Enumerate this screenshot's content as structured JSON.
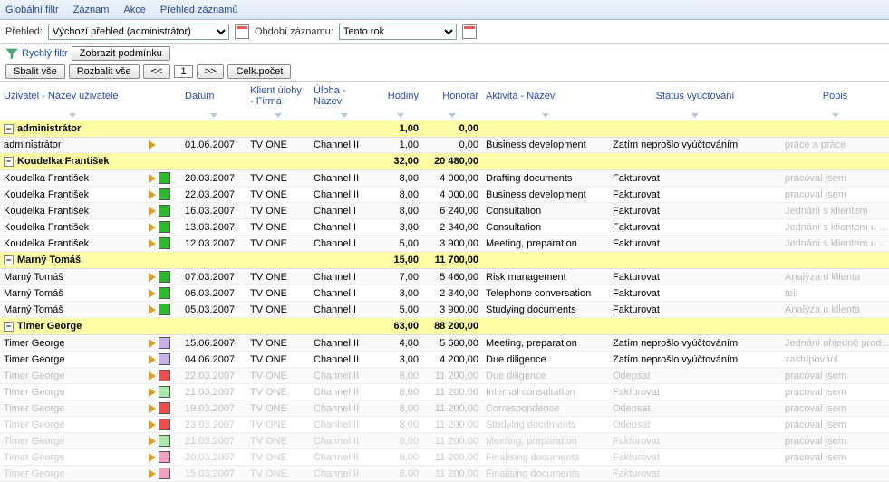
{
  "menu": [
    "Globální filtr",
    "Záznam",
    "Akce",
    "Přehled záznamů"
  ],
  "toolbar1": {
    "prehled_label": "Přehled:",
    "prehled_value": "Výchozí přehled (administrátor)",
    "obdobi_label": "Období záznamu:",
    "obdobi_value": "Tento rok"
  },
  "toolbar2": {
    "quick_filter": "Rychlý filtr",
    "show_condition": "Zobrazit podmínku"
  },
  "toolbar3": {
    "collapse_all": "Sbalit vše",
    "expand_all": "Rozbalit vše",
    "prev": "<<",
    "page": "1",
    "next": ">>",
    "total": "Celk.počet"
  },
  "headers": {
    "user": "Uživatel - Název uživatele",
    "date": "Datum",
    "client": "Klient úlohy - Firma",
    "task": "Úloha - Název",
    "hours": "Hodiny",
    "fee": "Honorář",
    "activity": "Aktivita - Název",
    "status": "Status vyúčtování",
    "desc": "Popis"
  },
  "groups": [
    {
      "name": "administrátor",
      "hours": "1,00",
      "fee": "0,00",
      "rows": [
        {
          "user": "administrátor",
          "sq": "",
          "date": "01.06.2007",
          "client": "TV ONE",
          "task": "Channel II",
          "hours": "1,00",
          "fee": "0,00",
          "activity": "Business development",
          "status": "Zatím neprošlo vyúčtováním",
          "desc": "práce a práce",
          "fade": 0
        }
      ]
    },
    {
      "name": "Koudelka František",
      "hours": "32,00",
      "fee": "20 480,00",
      "rows": [
        {
          "user": "Koudelka František",
          "sq": "green",
          "date": "20.03.2007",
          "client": "TV ONE",
          "task": "Channel II",
          "hours": "8,00",
          "fee": "4 000,00",
          "activity": "Drafting documents",
          "status": "Fakturovat",
          "desc": "pracoval jsem",
          "fade": 0
        },
        {
          "user": "Koudelka František",
          "sq": "green",
          "date": "22.03.2007",
          "client": "TV ONE",
          "task": "Channel II",
          "hours": "8,00",
          "fee": "4 000,00",
          "activity": "Business development",
          "status": "Fakturovat",
          "desc": "pracoval jsem",
          "fade": 0
        },
        {
          "user": "Koudelka František",
          "sq": "green",
          "date": "16.03.2007",
          "client": "TV ONE",
          "task": "Channel I",
          "hours": "8,00",
          "fee": "6 240,00",
          "activity": "Consultation",
          "status": "Fakturovat",
          "desc": "Jednání s klientem",
          "fade": 0
        },
        {
          "user": "Koudelka František",
          "sq": "green",
          "date": "13.03.2007",
          "client": "TV ONE",
          "task": "Channel I",
          "hours": "3,00",
          "fee": "2 340,00",
          "activity": "Consultation",
          "status": "Fakturovat",
          "desc": "Jednání s klientem u ...",
          "fade": 0
        },
        {
          "user": "Koudelka František",
          "sq": "green",
          "date": "12.03.2007",
          "client": "TV ONE",
          "task": "Channel I",
          "hours": "5,00",
          "fee": "3 900,00",
          "activity": "Meeting, preparation",
          "status": "Fakturovat",
          "desc": "Jednání s klientem u ...",
          "fade": 0
        }
      ]
    },
    {
      "name": "Marný Tomáš",
      "hours": "15,00",
      "fee": "11 700,00",
      "rows": [
        {
          "user": "Marný Tomáš",
          "sq": "green",
          "date": "07.03.2007",
          "client": "TV ONE",
          "task": "Channel I",
          "hours": "7,00",
          "fee": "5 460,00",
          "activity": "Risk management",
          "status": "Fakturovat",
          "desc": "Analýza u klienta",
          "fade": 0
        },
        {
          "user": "Marný Tomáš",
          "sq": "green",
          "date": "06.03.2007",
          "client": "TV ONE",
          "task": "Channel I",
          "hours": "3,00",
          "fee": "2 340,00",
          "activity": "Telephone conversation",
          "status": "Fakturovat",
          "desc": "tel",
          "fade": 0
        },
        {
          "user": "Marný Tomáš",
          "sq": "green",
          "date": "05.03.2007",
          "client": "TV ONE",
          "task": "Channel I",
          "hours": "5,00",
          "fee": "3 900,00",
          "activity": "Studying documents",
          "status": "Fakturovat",
          "desc": "Analýza u klienta",
          "fade": 0
        }
      ]
    },
    {
      "name": "Timer George",
      "hours": "63,00",
      "fee": "88 200,00",
      "rows": [
        {
          "user": "Timer George",
          "sq": "purple",
          "date": "15.06.2007",
          "client": "TV ONE",
          "task": "Channel II",
          "hours": "4,00",
          "fee": "5 600,00",
          "activity": "Meeting, preparation",
          "status": "Zatím neprošlo vyúčtováním",
          "desc": "Jednání ohledně prod...",
          "fade": 0
        },
        {
          "user": "Timer George",
          "sq": "purple",
          "date": "04.06.2007",
          "client": "TV ONE",
          "task": "Channel II",
          "hours": "3,00",
          "fee": "4 200,00",
          "activity": "Due diligence",
          "status": "Zatím neprošlo vyúčtováním",
          "desc": "zastupování",
          "fade": 0
        },
        {
          "user": "Timer George",
          "sq": "red",
          "date": "22.03.2007",
          "client": "TV ONE",
          "task": "Channel II",
          "hours": "8,00",
          "fee": "11 200,00",
          "activity": "Due diligence",
          "status": "Odepsat",
          "desc": "pracoval jsem",
          "fade": 1
        },
        {
          "user": "Timer George",
          "sq": "lgreen",
          "date": "21.03.2007",
          "client": "TV ONE",
          "task": "Channel II",
          "hours": "8,00",
          "fee": "11 200,00",
          "activity": "Internal consultation",
          "status": "Fakturovat",
          "desc": "pracoval jsem",
          "fade": 1
        },
        {
          "user": "Timer George",
          "sq": "red",
          "date": "19.03.2007",
          "client": "TV ONE",
          "task": "Channel II",
          "hours": "8,00",
          "fee": "11 200,00",
          "activity": "Correspondence",
          "status": "Odepsat",
          "desc": "pracoval jsem",
          "fade": 1
        },
        {
          "user": "Timer George",
          "sq": "red",
          "date": "23.03.2007",
          "client": "TV ONE",
          "task": "Channel II",
          "hours": "8,00",
          "fee": "11 200,00",
          "activity": "Studying documents",
          "status": "Odepsat",
          "desc": "pracoval jsem",
          "fade": 2
        },
        {
          "user": "Timer George",
          "sq": "lgreen",
          "date": "21.03.2007",
          "client": "TV ONE",
          "task": "Channel II",
          "hours": "8,00",
          "fee": "11 200,00",
          "activity": "Meeting, preparation",
          "status": "Fakturovat",
          "desc": "pracoval jsem",
          "fade": 2
        },
        {
          "user": "Timer George",
          "sq": "pink",
          "date": "20.03.2007",
          "client": "TV ONE",
          "task": "Channel II",
          "hours": "8,00",
          "fee": "11 200,00",
          "activity": "Finalising documents",
          "status": "Fakturovat",
          "desc": "pracoval jsem",
          "fade": 2
        },
        {
          "user": "Timer George",
          "sq": "pink",
          "date": "15.03.2007",
          "client": "TV ONE",
          "task": "Channel II",
          "hours": "8,00",
          "fee": "11 200,00",
          "activity": "Finalising documents",
          "status": "Fakturovat",
          "desc": "",
          "fade": 2
        }
      ]
    }
  ]
}
